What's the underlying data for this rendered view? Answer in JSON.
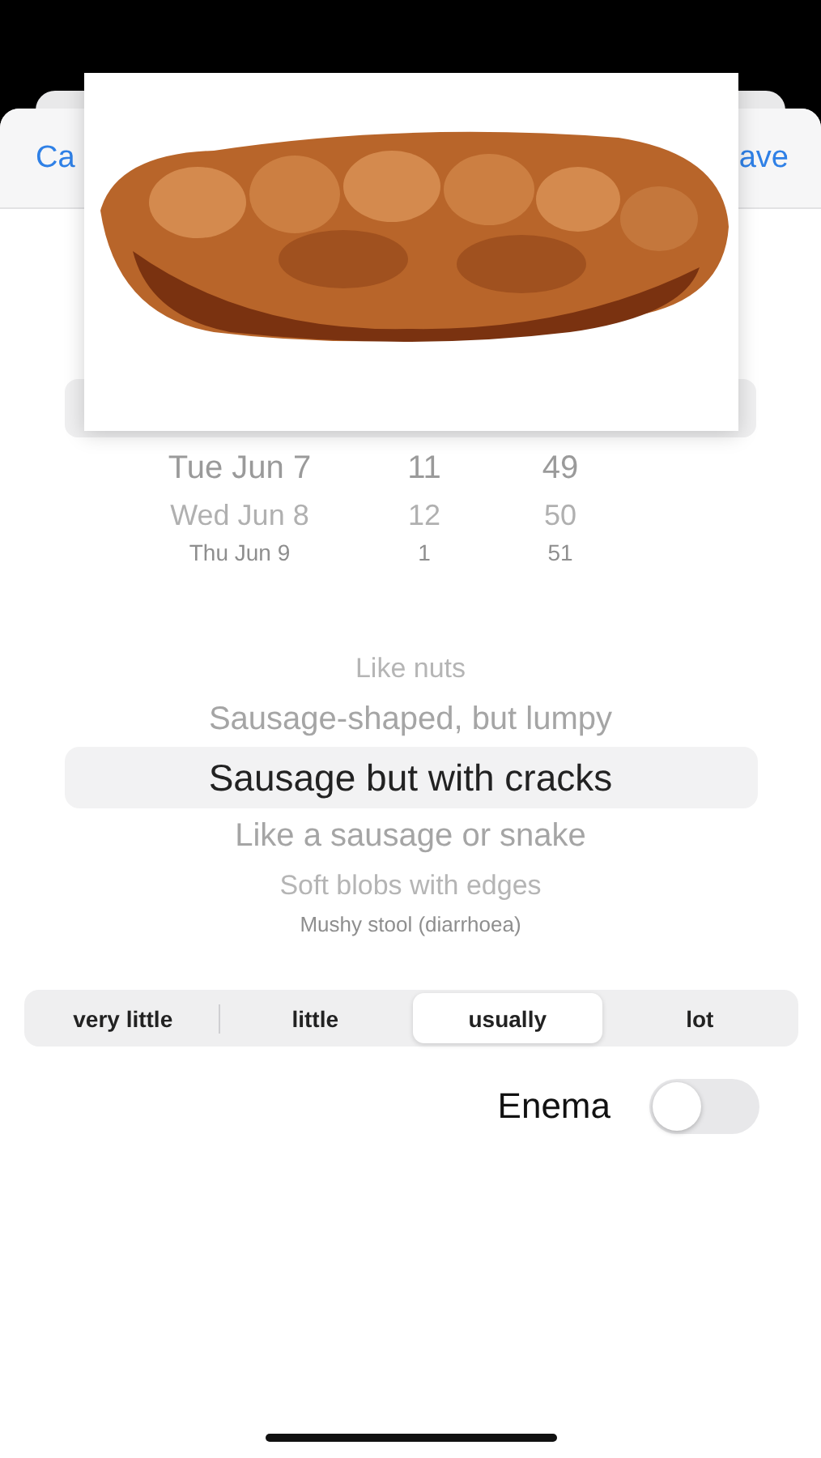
{
  "nav": {
    "cancel": "Ca",
    "save": "ave"
  },
  "date_picker": {
    "rows": [
      {
        "date": "Tue Jun 7",
        "hour": "11",
        "minute": "49"
      },
      {
        "date": "Wed Jun 8",
        "hour": "12",
        "minute": "50"
      },
      {
        "date": "Thu Jun 9",
        "hour": "1",
        "minute": "51"
      }
    ]
  },
  "stool_picker": {
    "items": [
      {
        "label": "Like nuts",
        "selected": false
      },
      {
        "label": "Sausage-shaped, but lumpy",
        "selected": false
      },
      {
        "label": "Sausage but with cracks",
        "selected": true
      },
      {
        "label": "Like a sausage or snake",
        "selected": false
      },
      {
        "label": "Soft blobs with edges",
        "selected": false
      },
      {
        "label": "Mushy stool (diarrhoea)",
        "selected": false
      }
    ]
  },
  "amount": [
    {
      "label": "very little",
      "selected": false
    },
    {
      "label": "little",
      "selected": false
    },
    {
      "label": "usually",
      "selected": true
    },
    {
      "label": "lot",
      "selected": false
    }
  ],
  "enema": {
    "label": "Enema",
    "on": false
  }
}
